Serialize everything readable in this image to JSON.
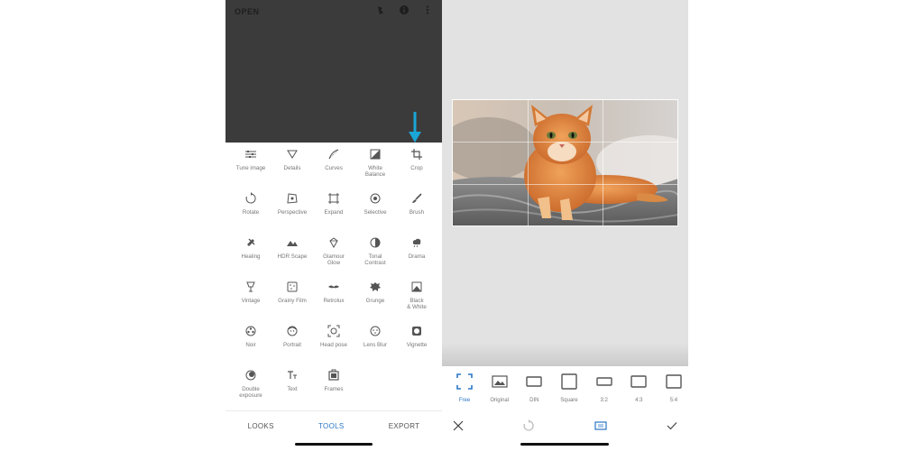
{
  "left": {
    "open_label": "OPEN",
    "top_icons": [
      "layers-icon",
      "info-icon",
      "more-vert-icon"
    ],
    "tools": [
      {
        "label": "Tune image",
        "icon": "tune-icon"
      },
      {
        "label": "Details",
        "icon": "details-icon"
      },
      {
        "label": "Curves",
        "icon": "curves-icon"
      },
      {
        "label": "White\nBalance",
        "icon": "white-balance-icon"
      },
      {
        "label": "Crop",
        "icon": "crop-icon"
      },
      {
        "label": "Rotate",
        "icon": "rotate-icon"
      },
      {
        "label": "Perspective",
        "icon": "perspective-icon"
      },
      {
        "label": "Expand",
        "icon": "expand-icon"
      },
      {
        "label": "Selective",
        "icon": "selective-icon"
      },
      {
        "label": "Brush",
        "icon": "brush-icon"
      },
      {
        "label": "Healing",
        "icon": "healing-icon"
      },
      {
        "label": "HDR Scape",
        "icon": "hdr-icon"
      },
      {
        "label": "Glamour\nGlow",
        "icon": "glamour-glow-icon"
      },
      {
        "label": "Tonal\nContrast",
        "icon": "tonal-contrast-icon"
      },
      {
        "label": "Drama",
        "icon": "drama-icon"
      },
      {
        "label": "Vintage",
        "icon": "vintage-icon"
      },
      {
        "label": "Grainy Film",
        "icon": "grainy-film-icon"
      },
      {
        "label": "Retrolux",
        "icon": "retrolux-icon"
      },
      {
        "label": "Grunge",
        "icon": "grunge-icon"
      },
      {
        "label": "Black\n& White",
        "icon": "black-white-icon"
      },
      {
        "label": "Noir",
        "icon": "noir-icon"
      },
      {
        "label": "Portrait",
        "icon": "portrait-icon"
      },
      {
        "label": "Head pose",
        "icon": "head-pose-icon"
      },
      {
        "label": "Lens Blur",
        "icon": "lens-blur-icon"
      },
      {
        "label": "Vignette",
        "icon": "vignette-icon"
      },
      {
        "label": "Double\nexposure",
        "icon": "double-exposure-icon"
      },
      {
        "label": "Text",
        "icon": "text-icon"
      },
      {
        "label": "Frames",
        "icon": "frames-icon"
      }
    ],
    "nav": {
      "looks": "LOOKS",
      "tools": "TOOLS",
      "export": "EXPORT"
    },
    "accent_color": "#2a76c6",
    "arrow_color": "#1aa6d6"
  },
  "right": {
    "ratios": [
      {
        "label": "Free",
        "selected": true
      },
      {
        "label": "Original",
        "selected": false
      },
      {
        "label": "DIN",
        "selected": false
      },
      {
        "label": "Square",
        "selected": false
      },
      {
        "label": "3:2",
        "selected": false
      },
      {
        "label": "4:3",
        "selected": false
      },
      {
        "label": "5:4",
        "selected": false
      }
    ],
    "actions": [
      "close-icon",
      "rotate-icon",
      "aspect-ratio-icon",
      "check-icon"
    ]
  }
}
